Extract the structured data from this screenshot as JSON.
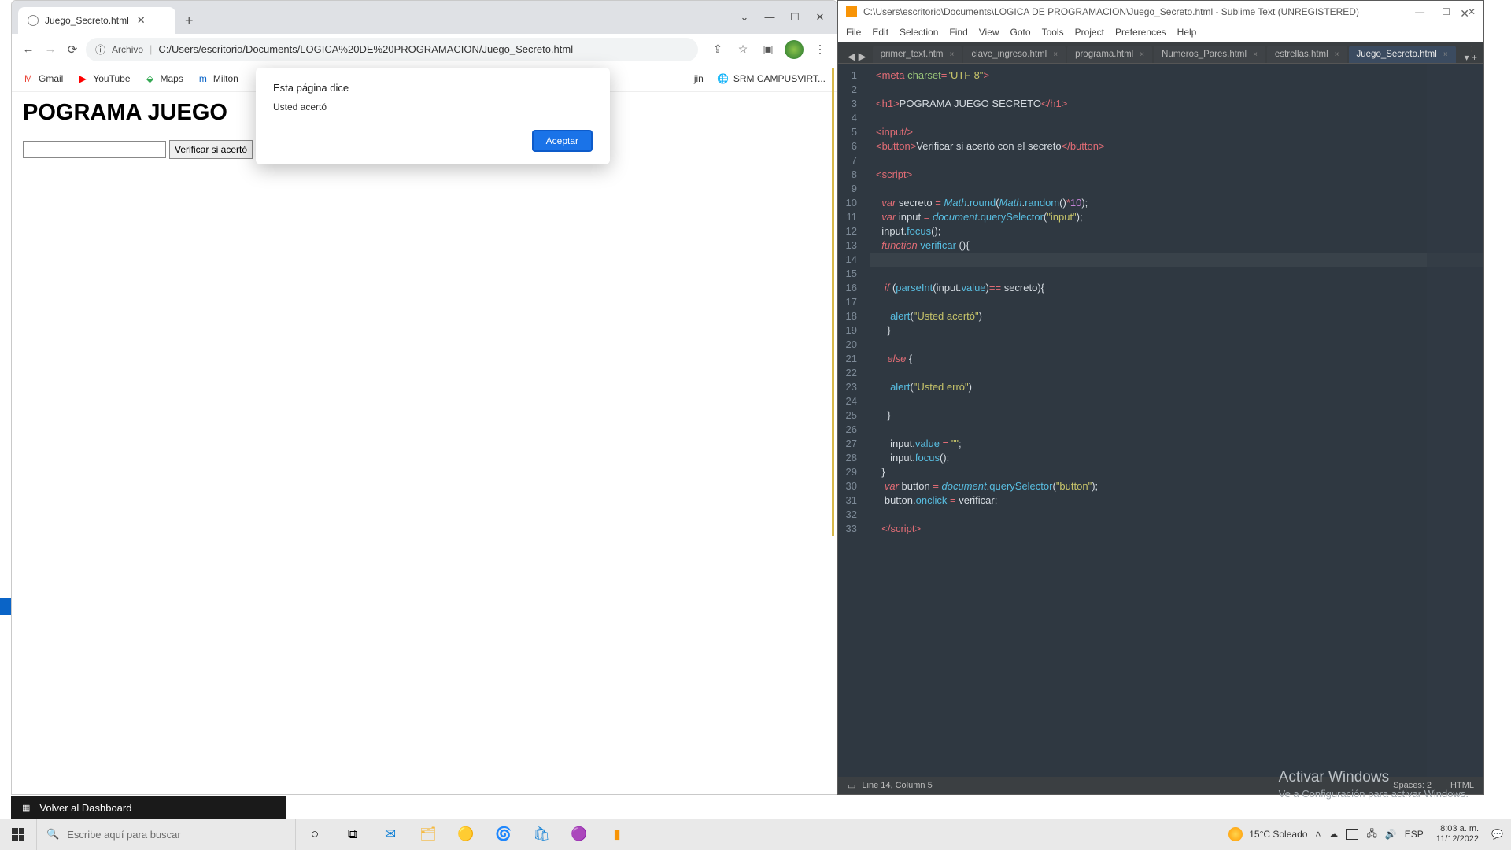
{
  "chrome": {
    "tab_title": "Juego_Secreto.html",
    "url_chip": "Archivo",
    "url": "C:/Users/escritorio/Documents/LOGICA%20DE%20PROGRAMACION/Juego_Secreto.html",
    "bookmarks": {
      "gmail": "Gmail",
      "youtube": "YouTube",
      "maps": "Maps",
      "milton": "Milton",
      "login": "jin",
      "srm": "SRM CAMPUSVIRT..."
    },
    "page": {
      "h1": "POGRAMA JUEGO",
      "button": "Verificar si acertó"
    },
    "alert": {
      "title": "Esta página dice",
      "message": "Usted acertó",
      "ok": "Aceptar"
    }
  },
  "sublime": {
    "title": "C:\\Users\\escritorio\\Documents\\LOGICA DE PROGRAMACION\\Juego_Secreto.html - Sublime Text (UNREGISTERED)",
    "menu": [
      "File",
      "Edit",
      "Selection",
      "Find",
      "View",
      "Goto",
      "Tools",
      "Project",
      "Preferences",
      "Help"
    ],
    "tabs": [
      "primer_text.htm",
      "clave_ingreso.html",
      "programa.html",
      "Numeros_Pares.html",
      "estrellas.html",
      "Juego_Secreto.html"
    ],
    "status_left": "Line 14, Column 5",
    "status_spaces": "Spaces: 2",
    "status_lang": "HTML",
    "lines": [
      {
        "n": 1,
        "h": "<span class='c-op'>&lt;</span><span class='c-tag'>meta</span> <span class='c-attr'>charset</span><span class='c-op'>=</span><span class='c-str'>\"UTF-8\"</span><span class='c-op'>&gt;</span>"
      },
      {
        "n": 2,
        "h": ""
      },
      {
        "n": 3,
        "h": "<span class='c-op'>&lt;</span><span class='c-tag'>h1</span><span class='c-op'>&gt;</span>POGRAMA JUEGO SECRETO<span class='c-op'>&lt;/</span><span class='c-tag'>h1</span><span class='c-op'>&gt;</span>"
      },
      {
        "n": 4,
        "h": ""
      },
      {
        "n": 5,
        "h": "<span class='c-op'>&lt;</span><span class='c-tag'>input</span><span class='c-op'>/&gt;</span>"
      },
      {
        "n": 6,
        "h": "<span class='c-op'>&lt;</span><span class='c-tag'>button</span><span class='c-op'>&gt;</span>Verificar si acertó con el secreto<span class='c-op'>&lt;/</span><span class='c-tag'>button</span><span class='c-op'>&gt;</span>"
      },
      {
        "n": 7,
        "h": ""
      },
      {
        "n": 8,
        "h": "<span class='c-op'>&lt;</span><span class='c-tag'>script</span><span class='c-op'>&gt;</span>"
      },
      {
        "n": 9,
        "h": ""
      },
      {
        "n": 10,
        "h": "  <span class='c-kw'>var</span> <span class='c-id'>secreto</span> <span class='c-op'>=</span> <span class='c-obj'>Math</span>.<span class='c-prop'>round</span>(<span class='c-obj'>Math</span>.<span class='c-prop'>random</span>()<span class='c-op'>*</span><span class='c-num'>10</span>);"
      },
      {
        "n": 11,
        "h": "  <span class='c-kw'>var</span> <span class='c-id'>input</span> <span class='c-op'>=</span> <span class='c-obj'>document</span>.<span class='c-prop'>querySelector</span>(<span class='c-str'>\"input\"</span>);"
      },
      {
        "n": 12,
        "h": "  <span class='c-id'>input</span>.<span class='c-prop'>focus</span>();"
      },
      {
        "n": 13,
        "h": "  <span class='c-kw'>function</span> <span class='c-fn'>verificar</span> (){"
      },
      {
        "n": 14,
        "h": "",
        "cursor": true
      },
      {
        "n": 15,
        "h": ""
      },
      {
        "n": 16,
        "h": "   <span class='c-kw'>if</span> (<span class='c-fn'>parseInt</span>(<span class='c-id'>input</span>.<span class='c-prop'>value</span>)<span class='c-op'>==</span> <span class='c-id'>secreto</span>){"
      },
      {
        "n": 17,
        "h": ""
      },
      {
        "n": 18,
        "h": "     <span class='c-fn'>alert</span>(<span class='c-str'>\"Usted acertó\"</span>)"
      },
      {
        "n": 19,
        "h": "    }"
      },
      {
        "n": 20,
        "h": ""
      },
      {
        "n": 21,
        "h": "    <span class='c-kw'>else</span> {"
      },
      {
        "n": 22,
        "h": ""
      },
      {
        "n": 23,
        "h": "     <span class='c-fn'>alert</span>(<span class='c-str'>\"Usted erró\"</span>)"
      },
      {
        "n": 24,
        "h": ""
      },
      {
        "n": 25,
        "h": "    }"
      },
      {
        "n": 26,
        "h": ""
      },
      {
        "n": 27,
        "h": "     <span class='c-id'>input</span>.<span class='c-prop'>value</span> <span class='c-op'>=</span> <span class='c-str'>\"\"</span>;"
      },
      {
        "n": 28,
        "h": "     <span class='c-id'>input</span>.<span class='c-prop'>focus</span>();"
      },
      {
        "n": 29,
        "h": "  }"
      },
      {
        "n": 30,
        "h": "   <span class='c-kw'>var</span> <span class='c-id'>button</span> <span class='c-op'>=</span> <span class='c-obj'>document</span>.<span class='c-prop'>querySelector</span>(<span class='c-str'>\"button\"</span>);"
      },
      {
        "n": 31,
        "h": "   <span class='c-id'>button</span>.<span class='c-prop'>onclick</span> <span class='c-op'>=</span> <span class='c-id'>verificar</span>;"
      },
      {
        "n": 32,
        "h": ""
      },
      {
        "n": 33,
        "h": "  <span class='c-op'>&lt;/</span><span class='c-tag'>script</span><span class='c-op'>&gt;</span>"
      }
    ]
  },
  "watermark": {
    "l1": "Activar Windows",
    "l2": "Ve a Configuración para activar Windows."
  },
  "dashboard_strip": "Volver al Dashboard",
  "taskbar": {
    "search_placeholder": "Escribe aquí para buscar",
    "weather": "15°C  Soleado",
    "lang": "ESP",
    "time": "8:03 a. m.",
    "date": "11/12/2022"
  }
}
